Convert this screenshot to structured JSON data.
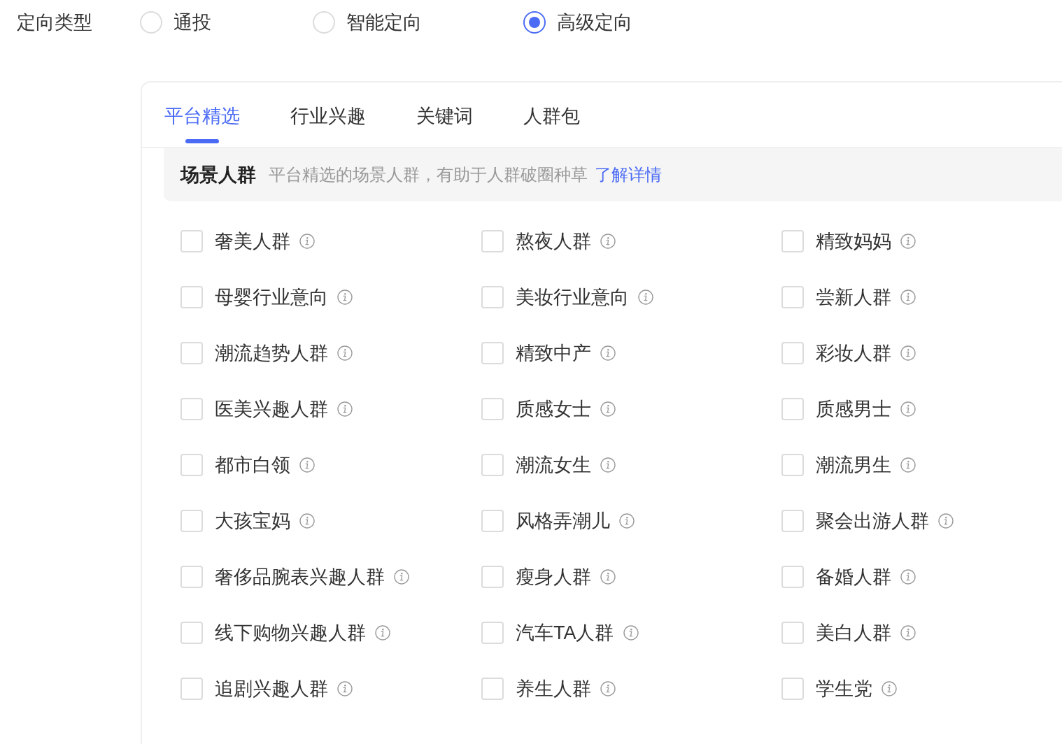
{
  "field": {
    "label": "定向类型"
  },
  "targeting_options": [
    {
      "label": "通投",
      "selected": false
    },
    {
      "label": "智能定向",
      "selected": false
    },
    {
      "label": "高级定向",
      "selected": true
    }
  ],
  "tabs": [
    {
      "label": "平台精选",
      "selected": true
    },
    {
      "label": "行业兴趣",
      "selected": false
    },
    {
      "label": "关键词",
      "selected": false
    },
    {
      "label": "人群包",
      "selected": false
    }
  ],
  "section": {
    "title": "场景人群",
    "description": "平台精选的场景人群，有助于人群破圈种草",
    "link": "了解详情"
  },
  "audiences": [
    {
      "label": "奢美人群",
      "checked": false
    },
    {
      "label": "熬夜人群",
      "checked": false
    },
    {
      "label": "精致妈妈",
      "checked": false
    },
    {
      "label": "母婴行业意向",
      "checked": false
    },
    {
      "label": "美妆行业意向",
      "checked": false
    },
    {
      "label": "尝新人群",
      "checked": false
    },
    {
      "label": "潮流趋势人群",
      "checked": false
    },
    {
      "label": "精致中产",
      "checked": false
    },
    {
      "label": "彩妆人群",
      "checked": false
    },
    {
      "label": "医美兴趣人群",
      "checked": false
    },
    {
      "label": "质感女士",
      "checked": false
    },
    {
      "label": "质感男士",
      "checked": false
    },
    {
      "label": "都市白领",
      "checked": false
    },
    {
      "label": "潮流女生",
      "checked": false
    },
    {
      "label": "潮流男生",
      "checked": false
    },
    {
      "label": "大孩宝妈",
      "checked": false
    },
    {
      "label": "风格弄潮儿",
      "checked": false
    },
    {
      "label": "聚会出游人群",
      "checked": false
    },
    {
      "label": "奢侈品腕表兴趣人群",
      "checked": false
    },
    {
      "label": "瘦身人群",
      "checked": false
    },
    {
      "label": "备婚人群",
      "checked": false
    },
    {
      "label": "线下购物兴趣人群",
      "checked": false
    },
    {
      "label": "汽车TA人群",
      "checked": false
    },
    {
      "label": "美白人群",
      "checked": false
    },
    {
      "label": "追剧兴趣人群",
      "checked": false
    },
    {
      "label": "养生人群",
      "checked": false
    },
    {
      "label": "学生党",
      "checked": false
    }
  ]
}
